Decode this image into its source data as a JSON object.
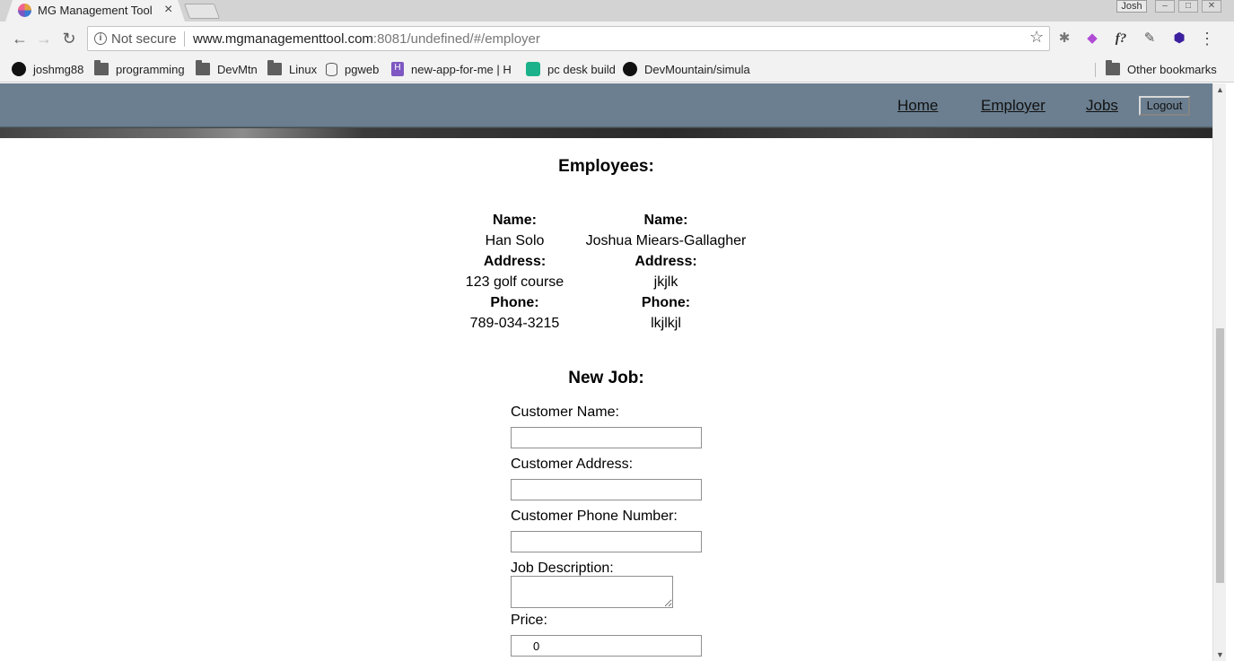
{
  "browser": {
    "tab_title": "MG Management Tool",
    "tab_close": "×",
    "profile_name": "Josh",
    "window_buttons": [
      "–",
      "□",
      "✕"
    ],
    "security_label": "Not secure",
    "url_host": "www.mgmanagementtool.com",
    "url_rest": ":8081/undefined/#/employer",
    "extensions": [
      "bug-icon",
      "paint-icon",
      "f?",
      "eyedropper-icon",
      "cube-icon"
    ]
  },
  "bookmarks": [
    {
      "label": "joshmg88",
      "icon": "github-icon"
    },
    {
      "label": "programming",
      "icon": "folder-icon"
    },
    {
      "label": "DevMtn",
      "icon": "folder-icon"
    },
    {
      "label": "Linux",
      "icon": "folder-icon"
    },
    {
      "label": "pgweb",
      "icon": "database-icon"
    },
    {
      "label": "new-app-for-me | H",
      "icon": "heroku-icon"
    },
    {
      "label": "pc desk build",
      "icon": "pcpartpicker-icon"
    },
    {
      "label": "DevMountain/simula",
      "icon": "github-icon"
    }
  ],
  "other_bookmarks": "Other bookmarks",
  "nav": {
    "home": "Home",
    "employer": "Employer",
    "jobs": "Jobs",
    "logout": "Logout"
  },
  "employees": {
    "heading": "Employees:",
    "list": [
      {
        "name_label": "Name:",
        "name": "Han Solo",
        "address_label": "Address:",
        "address": "123 golf course",
        "phone_label": "Phone:",
        "phone": "789-034-3215"
      },
      {
        "name_label": "Name:",
        "name": "Joshua Miears-Gallagher",
        "address_label": "Address:",
        "address": "jkjlk",
        "phone_label": "Phone:",
        "phone": "lkjlkjl"
      }
    ]
  },
  "new_job": {
    "heading": "New Job:",
    "customer_name_label": "Customer Name:",
    "customer_name_value": "",
    "customer_address_label": "Customer Address:",
    "customer_address_value": "",
    "customer_phone_label": "Customer Phone Number:",
    "customer_phone_value": "",
    "job_description_label": "Job Description:",
    "job_description_value": "",
    "price_label": "Price:",
    "price_value": "0"
  }
}
